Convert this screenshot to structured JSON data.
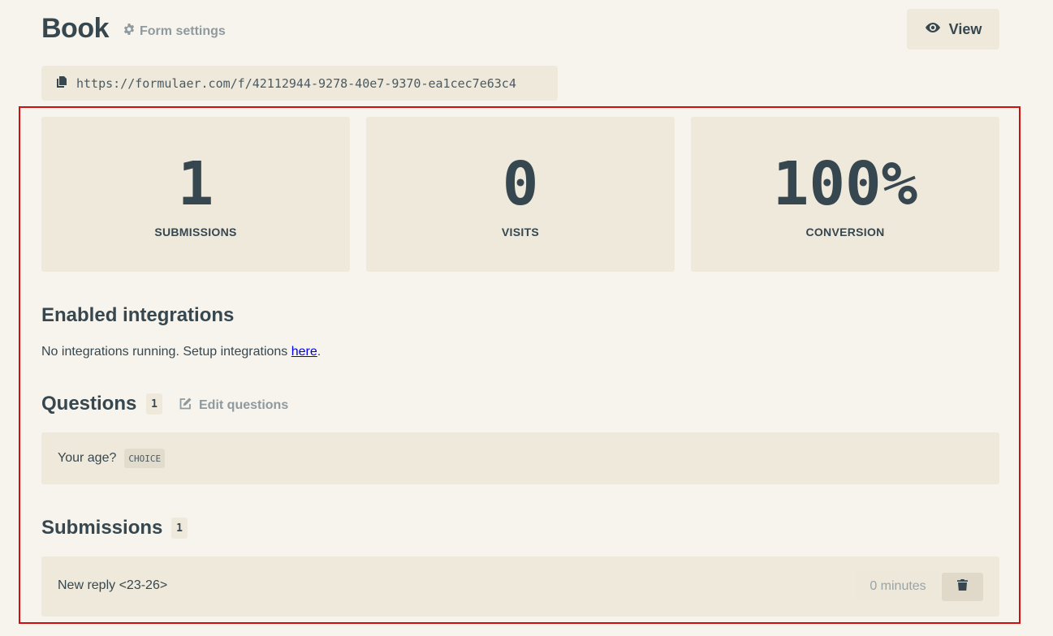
{
  "header": {
    "title": "Book",
    "settings_label": "Form settings",
    "view_label": "View"
  },
  "form_url": "https://formulaer.com/f/42112944-9278-40e7-9370-ea1cec7e63c4",
  "stats": [
    {
      "value": "1",
      "label": "SUBMISSIONS"
    },
    {
      "value": "0",
      "label": "VISITS"
    },
    {
      "value": "100%",
      "label": "CONVERSION"
    }
  ],
  "integrations": {
    "title": "Enabled integrations",
    "text": "No integrations running. Setup integrations ",
    "link_label": "here",
    "text_end": "."
  },
  "questions": {
    "title": "Questions",
    "count": "1",
    "edit_label": "Edit questions",
    "items": [
      {
        "text": "Your age?",
        "type": "CHOICE"
      }
    ]
  },
  "submissions": {
    "title": "Submissions",
    "count": "1",
    "items": [
      {
        "text": "New reply <23-26>",
        "time": "0 minutes"
      }
    ]
  },
  "icons": {
    "settings": "gear-icon",
    "view": "eye-icon",
    "copy": "copy-icon",
    "edit": "edit-icon",
    "delete": "trash-icon"
  },
  "colors": {
    "background": "#f7f4ed",
    "card": "#efe9dc",
    "text": "#36474f",
    "muted": "#8f9a9f",
    "link": "#0000ee",
    "highlight": "#d20d0d"
  }
}
